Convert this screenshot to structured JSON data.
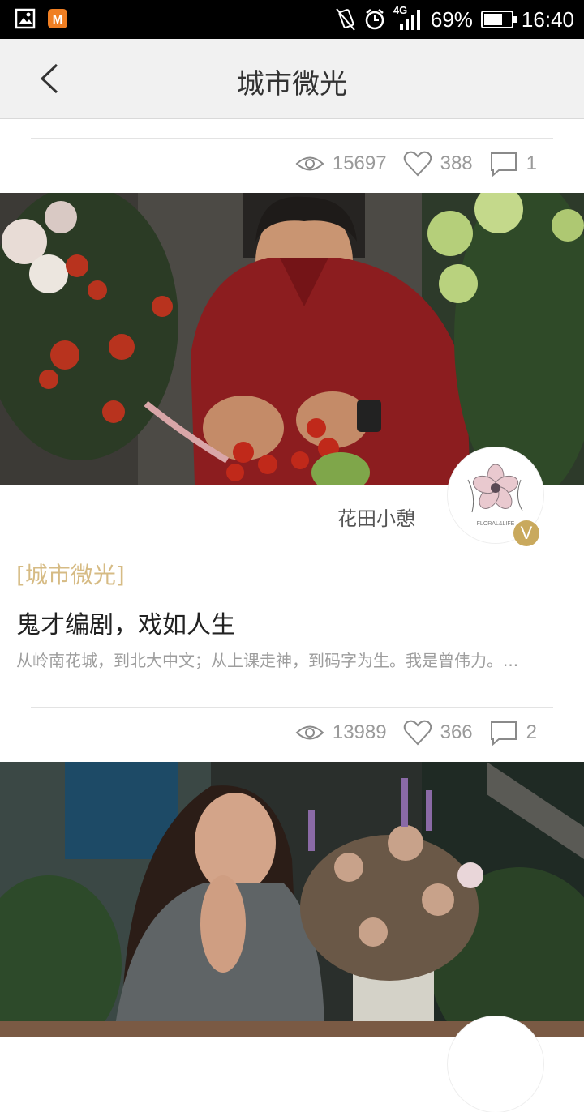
{
  "statusbar": {
    "network": "4G",
    "battery": "69%",
    "battery_level": 0.69,
    "time": "16:40"
  },
  "header": {
    "title": "城市微光",
    "back_icon": "chevron-left-icon"
  },
  "articles": [
    {
      "stats": {
        "views": "15697",
        "likes": "388",
        "comments": "1"
      }
    },
    {
      "author": "花田小憩",
      "avatar_caption": "FLORAL&LIFE",
      "verified_badge": "V",
      "tag": "[城市微光]",
      "title": "鬼才编剧，戏如人生",
      "summary": "从岭南花城，到北大中文；从上课走神，到码字为生。我是曾伟力。...",
      "stats": {
        "views": "13989",
        "likes": "366",
        "comments": "2"
      }
    }
  ],
  "colors": {
    "tag": "#d6bb84",
    "badge": "#c9a95d",
    "header_bg": "#f1f1f1",
    "stat_text": "#9a9a9a"
  }
}
